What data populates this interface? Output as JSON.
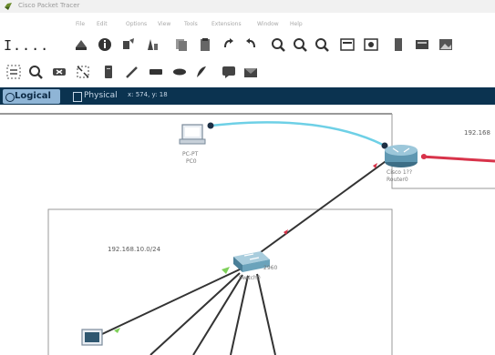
{
  "window": {
    "title": "Cisco Packet Tracer"
  },
  "menu": {
    "items": [
      "File",
      "Edit",
      "Options",
      "View",
      "Tools",
      "Extensions",
      "Window",
      "Help"
    ]
  },
  "side_glyph": "I....",
  "toolbar_primary": {
    "icons": [
      "network-icon",
      "info-icon",
      "activity-wizard-icon",
      "custom-device-icon",
      "copy-icon",
      "paste-icon",
      "undo-icon",
      "redo-icon",
      "zoom-in-icon",
      "zoom-reset-icon",
      "zoom-out-icon",
      "drawing-palette-icon",
      "custom-devices-dialog-icon",
      "view-icon",
      "storage-icon",
      "image-icon"
    ]
  },
  "toolbar_secondary": {
    "icons": [
      "select-icon",
      "inspect-icon",
      "delete-icon",
      "resize-icon",
      "note-icon",
      "draw-line-icon",
      "rectangle-icon",
      "ellipse-icon",
      "freeform-icon",
      "simple-pdu-icon",
      "complex-pdu-icon"
    ]
  },
  "modebar": {
    "logical_label": "Logical",
    "physical_label": "Physical",
    "coordinates": "x: 574, y: 18",
    "colors": {
      "bar": "#0b3350",
      "active_tab": "#8fb5d6"
    }
  },
  "topology": {
    "pc_top": {
      "model": "PC-PT",
      "name": "PC0"
    },
    "router": {
      "model": "Cisco 1??",
      "name": "Router0"
    },
    "switch": {
      "model": "2960",
      "name": "Switch0"
    },
    "network_main": "192.168.10.0/24",
    "network_right": "192.168"
  }
}
